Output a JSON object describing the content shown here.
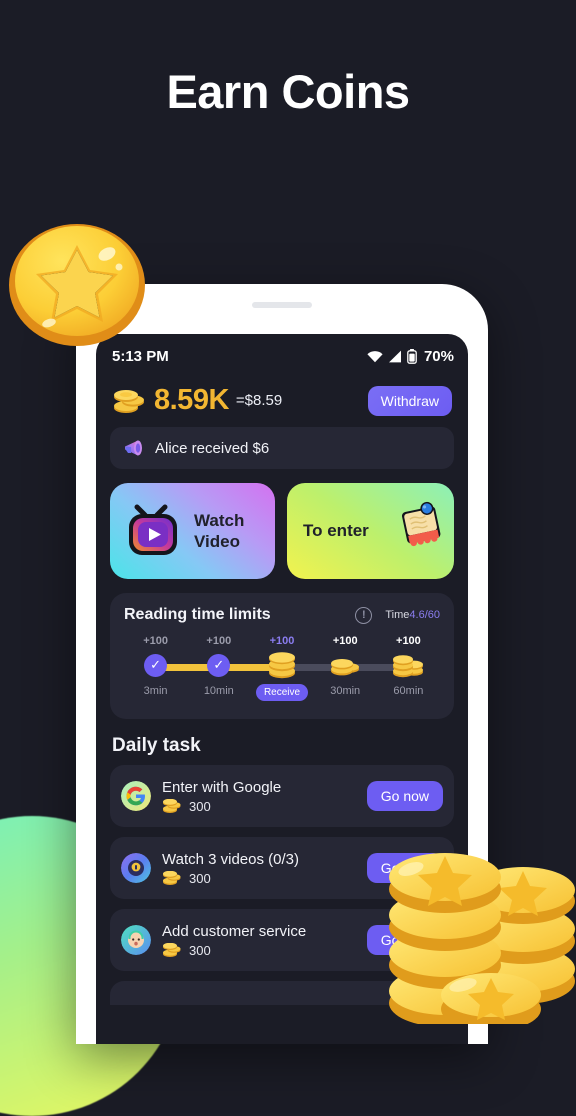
{
  "page": {
    "title": "Earn Coins"
  },
  "theme": {
    "bg": "#1b1c26",
    "card": "#262735",
    "accent_purple": "#6d5df2",
    "accent_gold": "#f2b632",
    "text": "#f2f3f8"
  },
  "status_bar": {
    "time": "5:13 PM",
    "battery_percent": "70%",
    "icons": [
      "wifi-icon",
      "cellular-signal-icon",
      "battery-icon"
    ]
  },
  "balance": {
    "coin_icon": "coin-stack-icon",
    "amount": "8.59K",
    "usd_equivalent": "=$8.59",
    "withdraw_label": "Withdraw"
  },
  "announcement": {
    "icon": "megaphone-icon",
    "text": "Alice received $6"
  },
  "actions": [
    {
      "id": "watch-video",
      "icon": "tv-play-icon",
      "label_line1": "Watch",
      "label_line2": "Video"
    },
    {
      "id": "to-enter",
      "icon": "notepad-pin-icon",
      "label_line1": "To enter",
      "label_line2": ""
    }
  ],
  "reading": {
    "title": "Reading time limits",
    "info_icon": "info-icon",
    "time_label": "Time",
    "time_value": "4.6/60",
    "milestones": [
      {
        "reward": "+100",
        "caption": "3min",
        "state": "claimed",
        "node": "check-icon"
      },
      {
        "reward": "+100",
        "caption": "10min",
        "state": "claimed",
        "node": "check-icon"
      },
      {
        "reward": "+100",
        "caption": "",
        "state": "claimable",
        "node": "coin-stack-icon",
        "button": "Receive"
      },
      {
        "reward": "+100",
        "caption": "30min",
        "state": "locked",
        "node": "coin-stack-icon"
      },
      {
        "reward": "+100",
        "caption": "60min",
        "state": "locked",
        "node": "coin-pile-icon"
      }
    ]
  },
  "daily_task": {
    "title": "Daily task",
    "tasks": [
      {
        "icon": "google-icon",
        "name": "Enter with Google",
        "reward": "300",
        "button": "Go now"
      },
      {
        "icon": "video-app-icon",
        "name": "Watch 3 videos  (0/3)",
        "reward": "300",
        "button": "Go now"
      },
      {
        "icon": "support-icon",
        "name": "Add customer service",
        "reward": "300",
        "button": "Go now"
      }
    ]
  },
  "decor": {
    "big_coin": "star-coin-icon",
    "coin_pile": "coin-pile-icon",
    "blob": "gradient-blob"
  }
}
